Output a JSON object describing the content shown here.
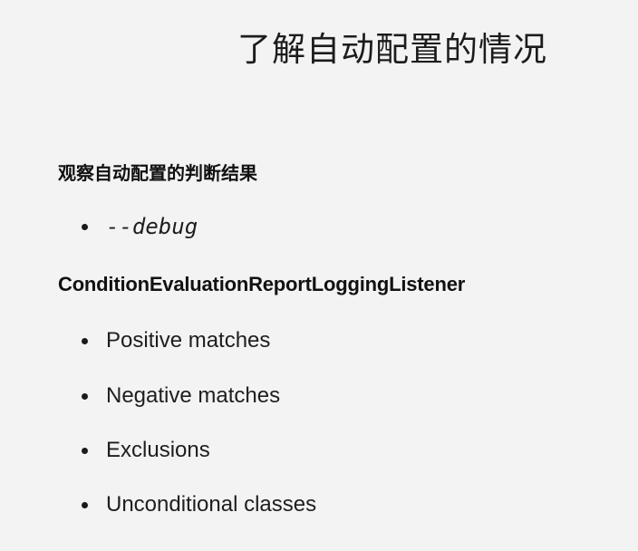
{
  "slide": {
    "title": "了解自动配置的情况",
    "section1": {
      "heading": "观察自动配置的判断结果",
      "bullets": [
        "--debug"
      ]
    },
    "section2": {
      "heading": "ConditionEvaluationReportLoggingListener",
      "bullets": [
        "Positive matches",
        "Negative matches",
        "Exclusions",
        "Unconditional classes"
      ]
    }
  }
}
